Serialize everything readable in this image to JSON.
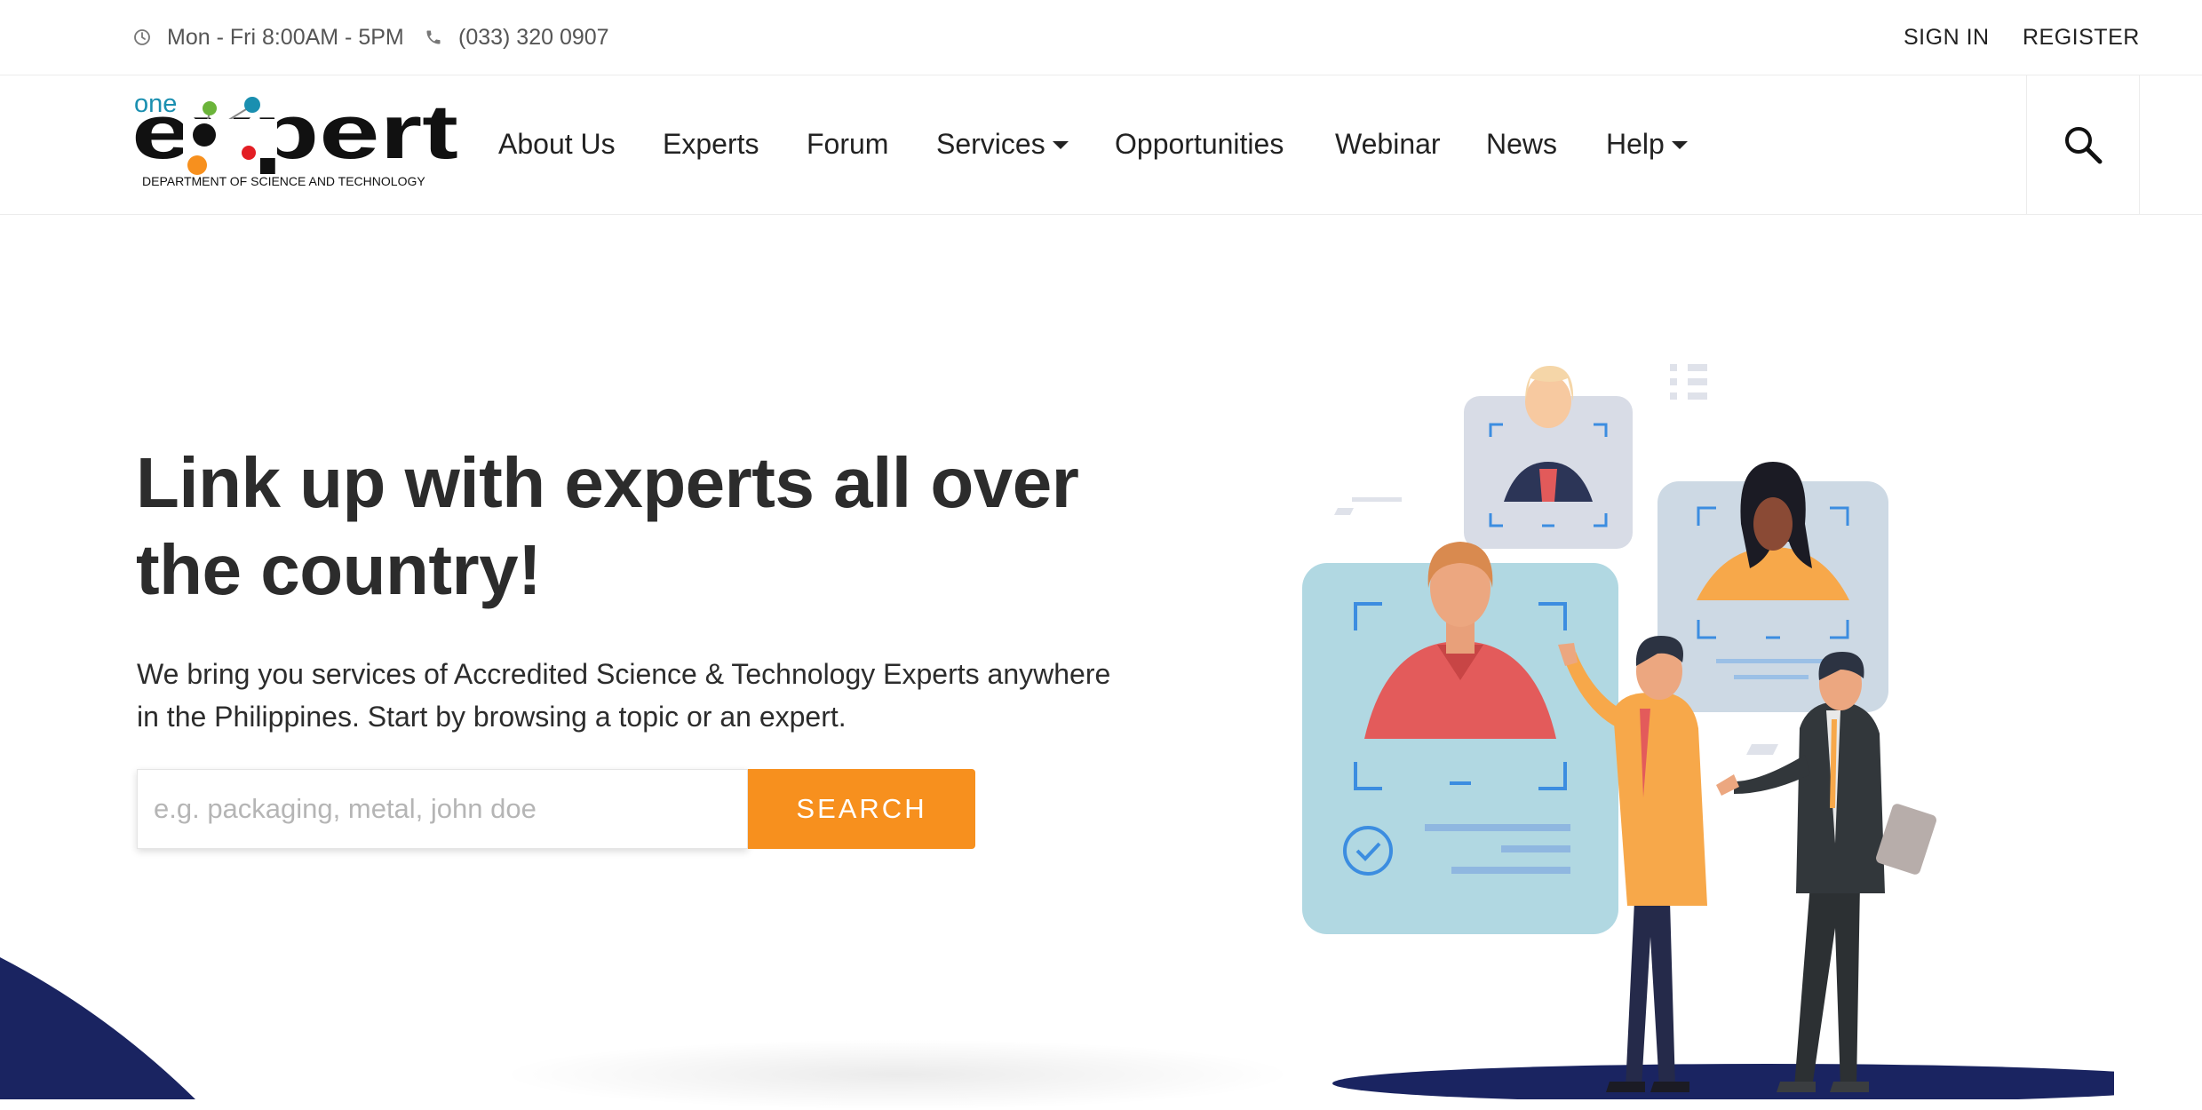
{
  "topbar": {
    "hours": "Mon - Fri 8:00AM - 5PM",
    "phone": "(033) 320 0907",
    "sign_in": "SIGN IN",
    "register": "REGISTER",
    "icons": [
      "clock-icon",
      "phone-icon"
    ]
  },
  "logo": {
    "word_small": "one",
    "word_main": "expert",
    "tagline": "DEPARTMENT OF SCIENCE AND TECHNOLOGY"
  },
  "nav": {
    "items": [
      {
        "label": "About Us",
        "dropdown": false
      },
      {
        "label": "Experts",
        "dropdown": false
      },
      {
        "label": "Forum",
        "dropdown": false
      },
      {
        "label": "Services",
        "dropdown": true
      },
      {
        "label": "Opportunities",
        "dropdown": false
      },
      {
        "label": "Webinar",
        "dropdown": false
      },
      {
        "label": "News",
        "dropdown": false
      },
      {
        "label": "Help",
        "dropdown": true
      }
    ],
    "search_icon": "search-icon"
  },
  "hero": {
    "title_line1": "Link up with experts all over",
    "title_line2": "the country!",
    "subtitle_line1": "We bring you services of Accredited Science & Technology Experts anywhere",
    "subtitle_line2": "in the Philippines. Start by browsing a topic or an expert.",
    "search_placeholder": "e.g. packaging, metal, john doe",
    "search_value": "",
    "search_button": "SEARCH"
  },
  "colors": {
    "accent": "#f7901e",
    "navy": "#1a2461",
    "text": "#2c2c2c",
    "logo_blue": "#1a8fb0"
  }
}
